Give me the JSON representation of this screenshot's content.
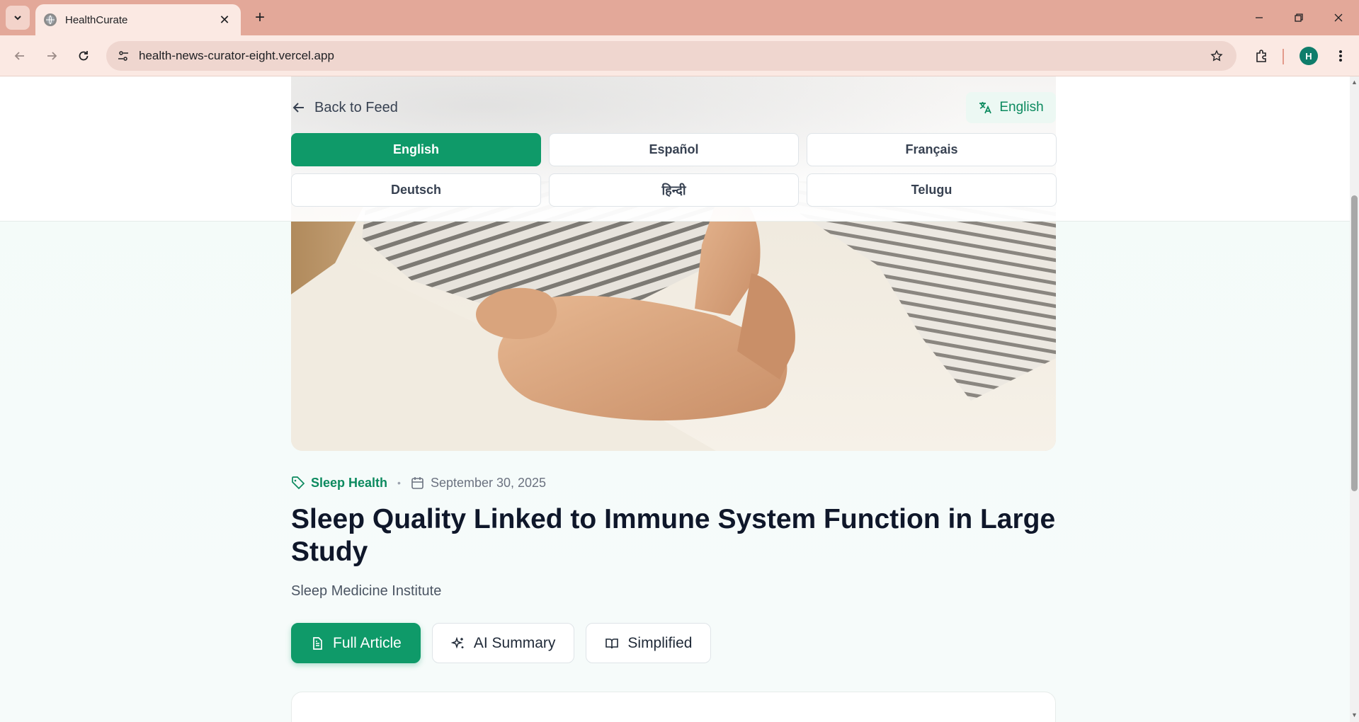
{
  "browser": {
    "tab_title": "HealthCurate",
    "url": "health-news-curator-eight.vercel.app",
    "profile_initial": "H"
  },
  "header": {
    "back_label": "Back to Feed",
    "current_language": "English",
    "languages": [
      {
        "label": "English",
        "active": true
      },
      {
        "label": "Español",
        "active": false
      },
      {
        "label": "Français",
        "active": false
      },
      {
        "label": "Deutsch",
        "active": false
      },
      {
        "label": "हिन्दी",
        "active": false
      },
      {
        "label": "Telugu",
        "active": false
      }
    ]
  },
  "article": {
    "category": "Sleep Health",
    "date": "September 30, 2025",
    "title": "Sleep Quality Linked to Immune System Function in Large Study",
    "source": "Sleep Medicine Institute",
    "view_tabs": [
      {
        "label": "Full Article",
        "active": true
      },
      {
        "label": "AI Summary",
        "active": false
      },
      {
        "label": "Simplified",
        "active": false
      }
    ]
  },
  "colors": {
    "accent": "#0f9a69",
    "accent_text": "#0c8a5f",
    "tabbar": "#e3a899"
  }
}
